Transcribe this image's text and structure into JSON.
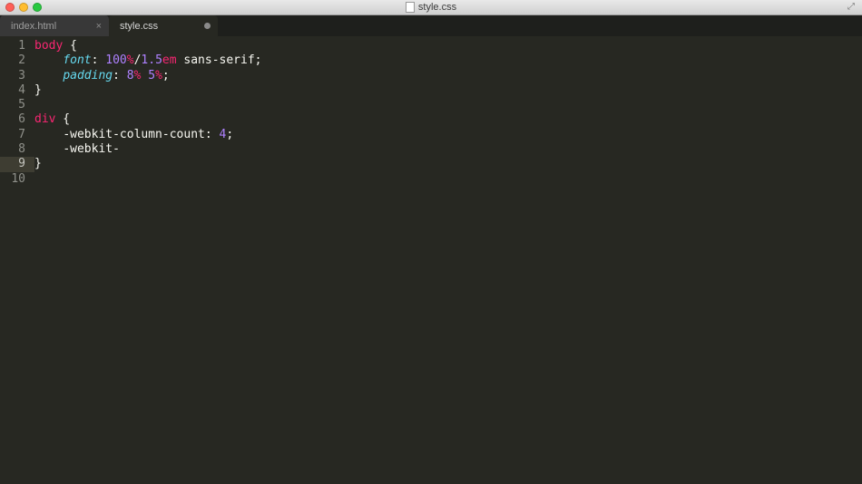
{
  "titlebar": {
    "filename": "style.css"
  },
  "tabs": [
    {
      "label": "index.html",
      "active": false,
      "dirty": false
    },
    {
      "label": "style.css",
      "active": true,
      "dirty": true
    }
  ],
  "editor": {
    "current_line": 9,
    "lines": [
      {
        "n": "1",
        "segs": [
          {
            "t": "body",
            "c": "sel"
          },
          {
            "t": " {",
            "c": "punct"
          }
        ]
      },
      {
        "n": "2",
        "segs": [
          {
            "t": "    ",
            "c": "plain"
          },
          {
            "t": "font",
            "c": "prop"
          },
          {
            "t": ": ",
            "c": "punct"
          },
          {
            "t": "100",
            "c": "num"
          },
          {
            "t": "%",
            "c": "unit"
          },
          {
            "t": "/",
            "c": "punct"
          },
          {
            "t": "1.5",
            "c": "num"
          },
          {
            "t": "em",
            "c": "unit"
          },
          {
            "t": " sans-serif",
            "c": "plain"
          },
          {
            "t": ";",
            "c": "punct"
          }
        ]
      },
      {
        "n": "3",
        "segs": [
          {
            "t": "    ",
            "c": "plain"
          },
          {
            "t": "padding",
            "c": "prop"
          },
          {
            "t": ": ",
            "c": "punct"
          },
          {
            "t": "8",
            "c": "num"
          },
          {
            "t": "%",
            "c": "unit"
          },
          {
            "t": " ",
            "c": "plain"
          },
          {
            "t": "5",
            "c": "num"
          },
          {
            "t": "%",
            "c": "unit"
          },
          {
            "t": ";",
            "c": "punct"
          }
        ]
      },
      {
        "n": "4",
        "segs": [
          {
            "t": "}",
            "c": "punct"
          }
        ]
      },
      {
        "n": "5",
        "segs": [
          {
            "t": "",
            "c": "plain"
          }
        ]
      },
      {
        "n": "6",
        "segs": [
          {
            "t": "div",
            "c": "sel"
          },
          {
            "t": " {",
            "c": "punct"
          }
        ]
      },
      {
        "n": "7",
        "segs": [
          {
            "t": "    ",
            "c": "plain"
          },
          {
            "t": "-webkit-column-count",
            "c": "plain"
          },
          {
            "t": ": ",
            "c": "punct"
          },
          {
            "t": "4",
            "c": "num"
          },
          {
            "t": ";",
            "c": "punct"
          }
        ]
      },
      {
        "n": "8",
        "segs": [
          {
            "t": "    ",
            "c": "plain"
          },
          {
            "t": "-webkit-",
            "c": "plain"
          }
        ]
      },
      {
        "n": "9",
        "segs": [
          {
            "t": "}",
            "c": "punct"
          }
        ]
      }
    ],
    "visible_line_numbers": [
      "1",
      "2",
      "3",
      "4",
      "5",
      "6",
      "7",
      "8",
      "9",
      "10"
    ]
  }
}
